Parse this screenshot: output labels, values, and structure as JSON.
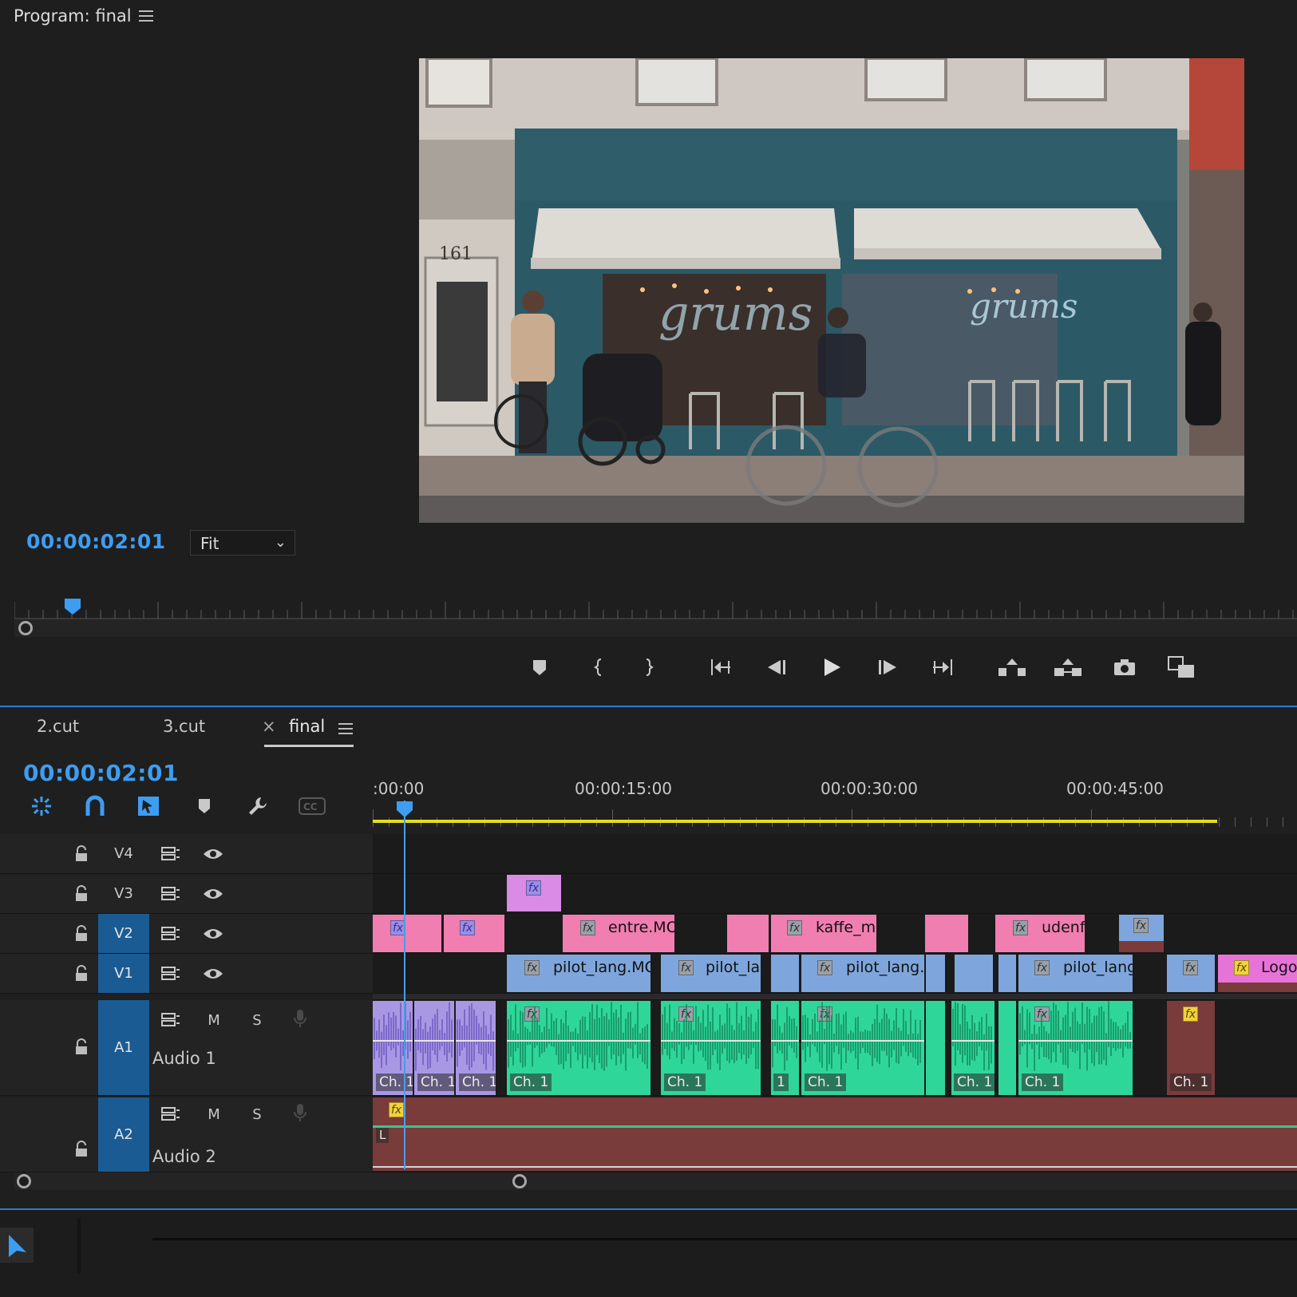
{
  "program_monitor": {
    "title": "Program: final",
    "timecode": "00:00:02:01",
    "zoom": "Fit"
  },
  "video": {
    "house_number": "161",
    "shop_script": "grums"
  },
  "timeline": {
    "tabs": [
      {
        "label": "2.cut"
      },
      {
        "label": "3.cut"
      },
      {
        "label": "final"
      }
    ],
    "close_glyph": "×",
    "timecode": "00:00:02:01",
    "ruler_labels": [
      ":00:00",
      "00:00:15:00",
      "00:00:30:00",
      "00:00:45:00"
    ],
    "tracks": {
      "v4": "V4",
      "v3": "V3",
      "v2": "V2",
      "v1": "V1",
      "a1": "A1",
      "a2": "A2",
      "audio1": "Audio 1",
      "audio2": "Audio 2",
      "mute": "M",
      "solo": "S"
    },
    "clips": {
      "v2_entre": "entre.MO",
      "v2_kaffe": "kaffe_m",
      "v2_udenf": "udenf",
      "v1_pilot1": "pilot_lang.MO",
      "v1_pilot2": "pilot_la",
      "v1_pilot3": "pilot_lang.",
      "v1_pilot4": "pilot_lang",
      "v1_logo": "Logo"
    },
    "fx_glyph": "fx",
    "channel_label": "Ch. 1",
    "channel_short": "1",
    "a2_marker": "L"
  },
  "colors": {
    "accent": "#3d9df2",
    "selected_track": "#1b5b94",
    "work_area": "#e5de1a",
    "clip_pink": "#f17eb1",
    "clip_blue": "#7ea6dc",
    "clip_green": "#2fd69a",
    "clip_audio2": "#7a3b3b"
  }
}
